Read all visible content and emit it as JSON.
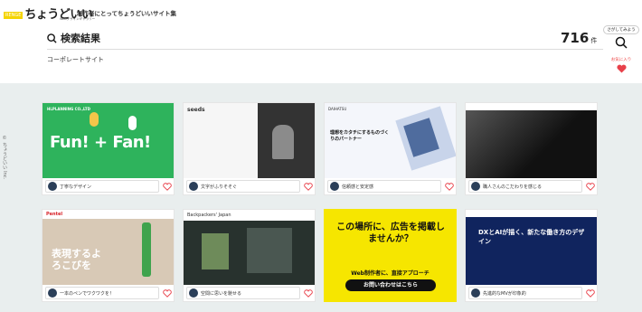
{
  "brand": {
    "badge": "RENGE",
    "name": "ちょうどいい",
    "sub": "Webデザインギャラリー"
  },
  "tagline": "制作者にとってちょうどいいサイト集",
  "search": {
    "title": "検索結果",
    "count": "716",
    "unit": "件",
    "category": "コーポレートサイト"
  },
  "tools": {
    "search_tip": "さがしてみよう",
    "favorite": "お気に入り"
  },
  "side_copy": "© ちょうどいい Inc.",
  "cards": [
    {
      "caption": "丁寧なデザイン",
      "thumb_text": "Fun! + Fan!",
      "thumb_sub": "HLPLANNING CO.,LTD"
    },
    {
      "caption": "文字がふりそそぐ",
      "thumb_text": "seeds",
      "thumb_sub": ""
    },
    {
      "caption": "信頼感と安定感",
      "thumb_text": "理想をカタチにするものづくりのパートナー",
      "thumb_sub": "DAIHATSU"
    },
    {
      "caption": "職人さんのこだわりを感じる",
      "thumb_text": "",
      "thumb_sub": ""
    },
    {
      "caption": "一本のペンでワクワクを！",
      "thumb_text": "表現するよろこびを",
      "thumb_sub": "Pentel"
    },
    {
      "caption": "空間に思いを馳せる",
      "thumb_text": "",
      "thumb_sub": "Backpackers' Japan"
    },
    {
      "caption": "",
      "thumb_text": "この場所に、広告を掲載しませんか？",
      "thumb_sub": "Web制作者に、直接アプローチ",
      "cta": "お問い合わせはこちら"
    },
    {
      "caption": "先進的なMVが印象的",
      "thumb_text": "DXとAIが描く、新たな働き方のデザイン",
      "thumb_sub": ""
    }
  ]
}
